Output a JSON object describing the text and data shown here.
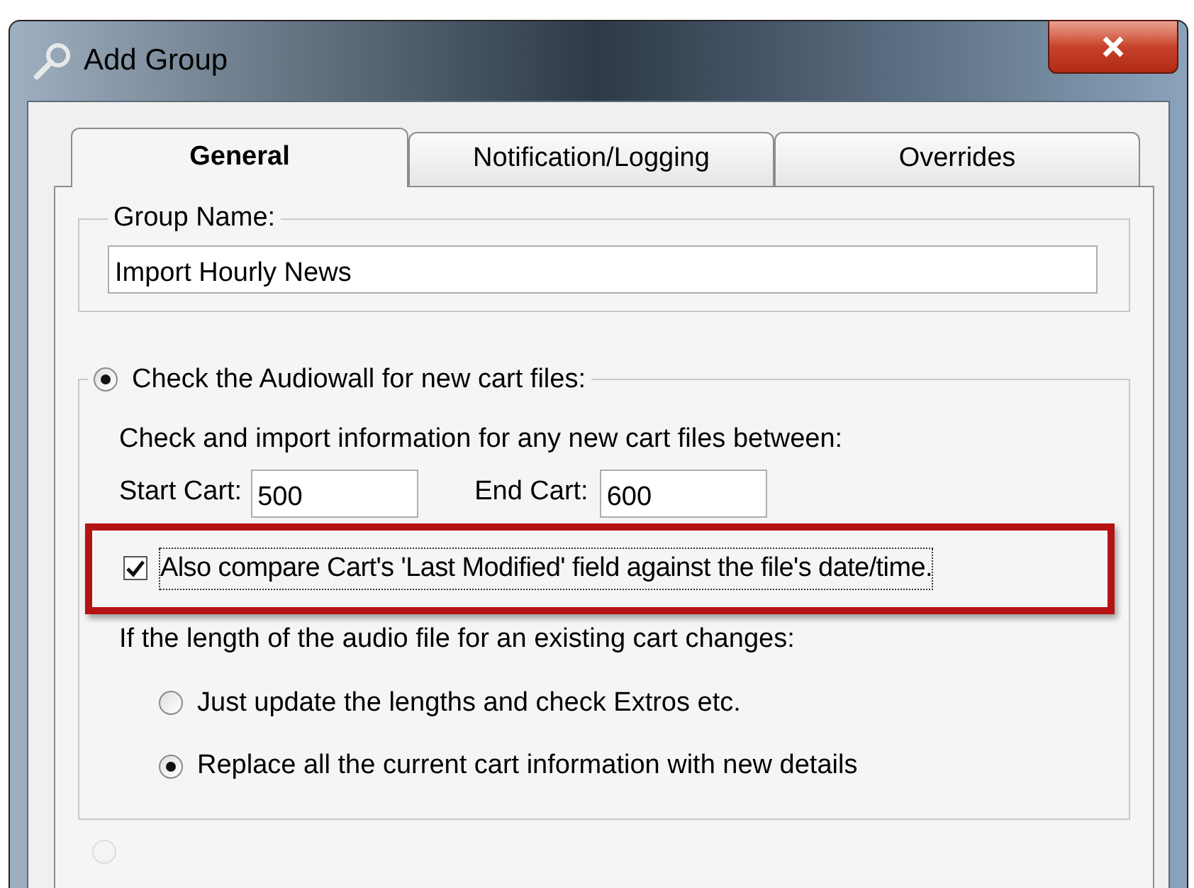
{
  "window": {
    "title": "Add Group"
  },
  "tabs": [
    {
      "label": "General",
      "selected": true
    },
    {
      "label": "Notification/Logging",
      "selected": false
    },
    {
      "label": "Overrides",
      "selected": false
    }
  ],
  "group_name": {
    "label": "Group Name:",
    "value": "Import Hourly News"
  },
  "audiowall": {
    "label": "Check the Audiowall for new cart files:",
    "selected": true,
    "intro": "Check and import information for any new cart files between:",
    "start_cart": {
      "label": "Start Cart:",
      "value": "500"
    },
    "end_cart": {
      "label": "End Cart:",
      "value": "600"
    },
    "compare": {
      "label": "Also compare Cart's 'Last Modified' field against the file's date/time.",
      "checked": true
    },
    "length_prompt": "If the length of the audio file for an existing cart changes:",
    "length_options": [
      {
        "label": "Just update the lengths and check Extros etc.",
        "selected": false
      },
      {
        "label": "Replace all the current cart information with new details",
        "selected": true
      }
    ]
  },
  "cut_off_option": {
    "selected": false,
    "disabled": true
  }
}
